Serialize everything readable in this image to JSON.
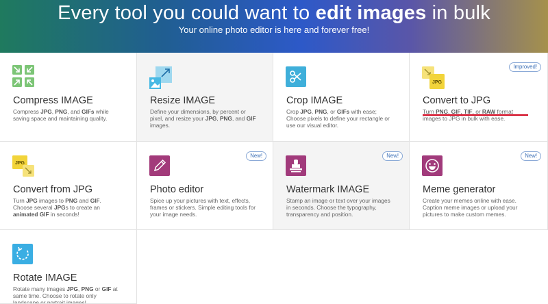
{
  "hero": {
    "title_pre": "Every tool you could want to ",
    "title_bold": "edit images",
    "title_post": " in bulk",
    "subtitle": "Your online photo editor is here and forever free!"
  },
  "badges": {
    "improved": "Improved!",
    "new": "New!"
  },
  "colors": {
    "compress": "#7cc576",
    "resize": "#48b9e4",
    "crop": "#3fafda",
    "convert": "#f2d43a",
    "photo_editor": "#a23a7a",
    "watermark": "#a13a7b",
    "meme": "#a13a7b",
    "rotate": "#3aaee3",
    "underline": "#d0021b"
  },
  "tools": {
    "compress": {
      "icon": "compress-icon",
      "title": "Compress IMAGE",
      "d1": "Compress ",
      "b1": "JPG",
      "d2": ", ",
      "b2": "PNG",
      "d3": ", and ",
      "b3": "GIFs",
      "d4": " while saving space and maintaining quality."
    },
    "resize": {
      "icon": "resize-icon",
      "title": "Resize IMAGE",
      "d1": "Define your dimensions, by percent or pixel, and resize your ",
      "b1": "JPG",
      "d2": ", ",
      "b2": "PNG",
      "d3": ", and ",
      "b3": "GIF",
      "d4": " images."
    },
    "crop": {
      "icon": "scissors-icon",
      "title": "Crop IMAGE",
      "d1": "Crop ",
      "b1": "JPG",
      "d2": ", ",
      "b2": "PNG",
      "d3": ", or ",
      "b3": "GIFs",
      "d4": " with ease; Choose pixels to define your rectangle or use our visual editor."
    },
    "to_jpg": {
      "icon": "convert-to-jpg-icon",
      "icon_label": "JPG",
      "title": "Convert to JPG",
      "d1": "Turn ",
      "b1": "PNG",
      "d2": ", ",
      "b2": "GIF",
      "d3": ", ",
      "b3": "TIF",
      "d4": ", or ",
      "b4": "RAW",
      "d5": " format images to JPG in bulk with ease."
    },
    "from_jpg": {
      "icon": "convert-from-jpg-icon",
      "icon_label": "JPG",
      "title": "Convert from JPG",
      "d1": "Turn ",
      "b1": "JPG",
      "d2": " images to ",
      "b2": "PNG",
      "d3": " and ",
      "b3": "GIF",
      "d4": ". Choose several ",
      "b4": "JPG",
      "d5": "s to create an ",
      "b5": "animated GIF",
      "d6": " in seconds!"
    },
    "photo_editor": {
      "icon": "pencil-icon",
      "title": "Photo editor",
      "desc": "Spice up your pictures with text, effects, frames or stickers. Simple editing tools for your image needs."
    },
    "watermark": {
      "icon": "stamp-icon",
      "title": "Watermark IMAGE",
      "desc": "Stamp an image or text over your images in seconds. Choose the typography, transparency and position."
    },
    "meme": {
      "icon": "smiley-icon",
      "title": "Meme generator",
      "desc": "Create your memes online with ease. Caption meme images or upload your pictures to make custom memes."
    },
    "rotate": {
      "icon": "rotate-icon",
      "title": "Rotate IMAGE",
      "d1": "Rotate many images ",
      "b1": "JPG",
      "d2": ", ",
      "b2": "PNG",
      "d3": " or ",
      "b3": "GIF",
      "d4": " at same time. Choose to rotate only landscape or portrait images!"
    }
  }
}
